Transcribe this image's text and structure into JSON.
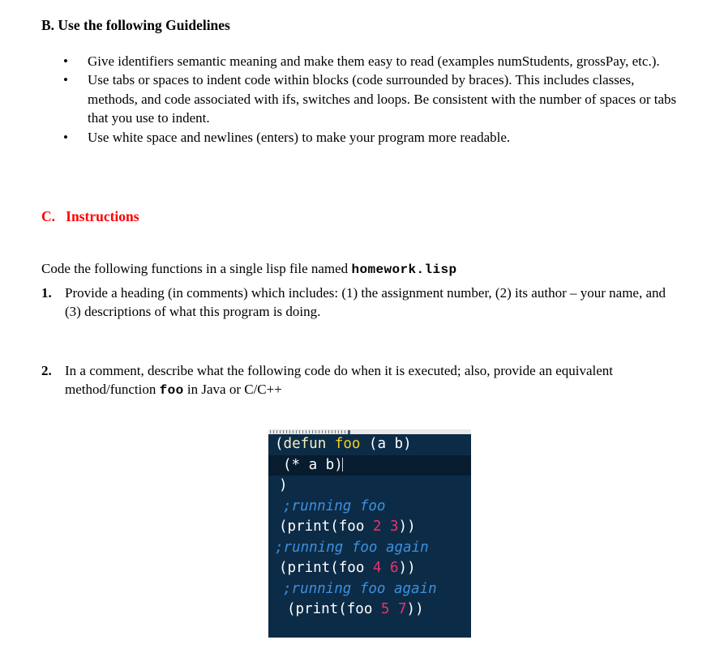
{
  "document": {
    "background_color": "#ffffff",
    "text_color": "#000000",
    "accent_color": "#ff0000"
  },
  "section_b": {
    "heading": "B. Use the following Guidelines",
    "bullet_glyph": "•",
    "items": [
      "Give identifiers semantic meaning and make them easy to read (examples numStudents, grossPay, etc.).",
      "Use tabs or spaces to indent code within blocks (code surrounded by braces). This includes classes, methods, and code associated with ifs, switches and loops. Be consistent with the number of spaces or tabs that you use to indent.",
      "Use white space and newlines (enters) to make your program more readable."
    ]
  },
  "section_c": {
    "heading": "C.   Instructions",
    "heading_color": "#ff0000",
    "intro_prefix": "Code the following functions in a single lisp file named ",
    "intro_filename": "homework.lisp",
    "tasks": [
      {
        "number": "1.",
        "text": "Provide a heading (in comments) which includes: (1) the assignment number, (2) its author – your name, and (3) descriptions of what this program is doing."
      },
      {
        "number": "2.",
        "text_before": "In a comment, describe what the following code do when it is executed; also, provide an equivalent method/function ",
        "text_code": "foo",
        "text_after": " in Java or C/C++"
      }
    ]
  },
  "code_block": {
    "background_color": "#0c2b46",
    "highlight_color": "#071d2f",
    "language": "lisp",
    "colors": {
      "paren": "#ffffff",
      "keyword": "#f4f0c0",
      "function_name": "#f2d024",
      "number": "#e8336d",
      "comment": "#3e8fdd"
    },
    "lines": [
      {
        "indent": 0,
        "highlighted": false,
        "tokens": [
          {
            "text": "(",
            "type": "paren"
          },
          {
            "text": "defun",
            "type": "keyword"
          },
          {
            "text": " ",
            "type": "symbol"
          },
          {
            "text": "foo",
            "type": "function_name"
          },
          {
            "text": " (a b)",
            "type": "paren"
          }
        ]
      },
      {
        "indent": 2,
        "highlighted": true,
        "tokens": [
          {
            "text": "(* a b)",
            "type": "paren"
          }
        ]
      },
      {
        "indent": 1,
        "highlighted": false,
        "tokens": [
          {
            "text": ")",
            "type": "paren"
          }
        ]
      },
      {
        "indent": 2,
        "highlighted": false,
        "tokens": [
          {
            "text": ";running foo",
            "type": "comment"
          }
        ]
      },
      {
        "indent": 1,
        "highlighted": false,
        "tokens": [
          {
            "text": "(print(foo ",
            "type": "paren"
          },
          {
            "text": "2",
            "type": "number"
          },
          {
            "text": " ",
            "type": "symbol"
          },
          {
            "text": "3",
            "type": "number"
          },
          {
            "text": "))",
            "type": "paren"
          }
        ]
      },
      {
        "indent": 0,
        "highlighted": false,
        "tokens": [
          {
            "text": ";running foo again",
            "type": "comment"
          }
        ]
      },
      {
        "indent": 1,
        "highlighted": false,
        "tokens": [
          {
            "text": "(print(foo ",
            "type": "paren"
          },
          {
            "text": "4",
            "type": "number"
          },
          {
            "text": " ",
            "type": "symbol"
          },
          {
            "text": "6",
            "type": "number"
          },
          {
            "text": "))",
            "type": "paren"
          }
        ]
      },
      {
        "indent": 2,
        "highlighted": false,
        "tokens": [
          {
            "text": ";running foo again",
            "type": "comment"
          }
        ]
      },
      {
        "indent": 3,
        "highlighted": false,
        "tokens": [
          {
            "text": "(print(foo ",
            "type": "paren"
          },
          {
            "text": "5",
            "type": "number"
          },
          {
            "text": " ",
            "type": "symbol"
          },
          {
            "text": "7",
            "type": "number"
          },
          {
            "text": "))",
            "type": "paren"
          }
        ]
      }
    ]
  }
}
